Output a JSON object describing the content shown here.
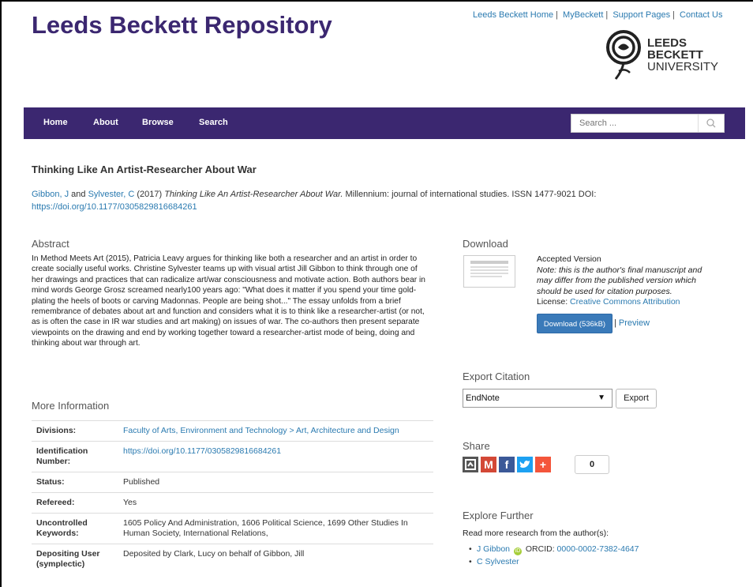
{
  "header": {
    "site_title": "Leeds Beckett Repository",
    "top_links": [
      "Leeds Beckett Home",
      "MyBeckett",
      "Support Pages",
      "Contact Us"
    ],
    "logo_lines": [
      "LEEDS",
      "BECKETT",
      "UNIVERSITY"
    ]
  },
  "nav": {
    "items": [
      "Home",
      "About",
      "Browse",
      "Search"
    ],
    "search_placeholder": "Search ...",
    "color": "#3b2770"
  },
  "item": {
    "title": "Thinking Like An Artist-Researcher About War",
    "author1": "Gibbon, J",
    "and": "and",
    "author2": "Sylvester, C",
    "year": "(2017)",
    "cite_title": "Thinking Like An Artist-Researcher About War.",
    "cite_rest": "Millennium: journal of international studies. ISSN 1477-9021 DOI:",
    "doi_link": "https://doi.org/10.1177/0305829816684261"
  },
  "abstract": {
    "heading": "Abstract",
    "text": "In Method Meets Art (2015), Patricia Leavy argues for thinking like both a researcher and an artist in order to create socially useful works. Christine Sylvester teams up with visual artist Jill Gibbon to think through one of her drawings and practices that can radicalize art/war consciousness and motivate action. Both authors bear in mind words George Grosz screamed nearly100 years ago: \"What does it matter if you spend your time gold-plating the heels of boots or carving Madonnas. People are being shot...\" The essay unfolds from a brief remembrance of debates about art and function and considers what it is to think like a researcher-artist (or not, as is often the case in IR war studies and art making) on issues of war. The co-authors then present separate viewpoints on the drawing and end by working together toward a researcher-artist mode of being, doing and thinking about war through art."
  },
  "more_info": {
    "heading": "More Information",
    "rows": [
      {
        "key": "Divisions:",
        "value": "Faculty of Arts, Environment and Technology > Art, Architecture and Design",
        "link": true
      },
      {
        "key": "Identification Number:",
        "value": "https://doi.org/10.1177/0305829816684261",
        "link": true
      },
      {
        "key": "Status:",
        "value": "Published",
        "link": false
      },
      {
        "key": "Refereed:",
        "value": "Yes",
        "link": false
      },
      {
        "key": "Uncontrolled Keywords:",
        "value": "1605 Policy And Administration, 1606 Political Science, 1699 Other Studies In Human Society, International Relations,",
        "link": false
      },
      {
        "key": "Depositing User (symplectic)",
        "value": "Deposited by Clark, Lucy on behalf of Gibbon, Jill",
        "link": false
      }
    ]
  },
  "download": {
    "heading": "Download",
    "version": "Accepted Version",
    "note": "Note: this is the author's final manuscript and may differ from the published version which should be used for citation purposes.",
    "license_label": "License:",
    "license_value": "Creative Commons Attribution",
    "button": "Download (536kB)",
    "separator": "|",
    "preview": "Preview"
  },
  "export": {
    "heading": "Export Citation",
    "selected": "EndNote",
    "button": "Export"
  },
  "share": {
    "heading": "Share",
    "count": "0"
  },
  "explore": {
    "heading": "Explore Further",
    "text": "Read more research from the author(s):",
    "author1": "J Gibbon",
    "orcid_label": "ORCID:",
    "orcid_value": "0000-0002-7382-4647",
    "author2": "C Sylvester"
  }
}
